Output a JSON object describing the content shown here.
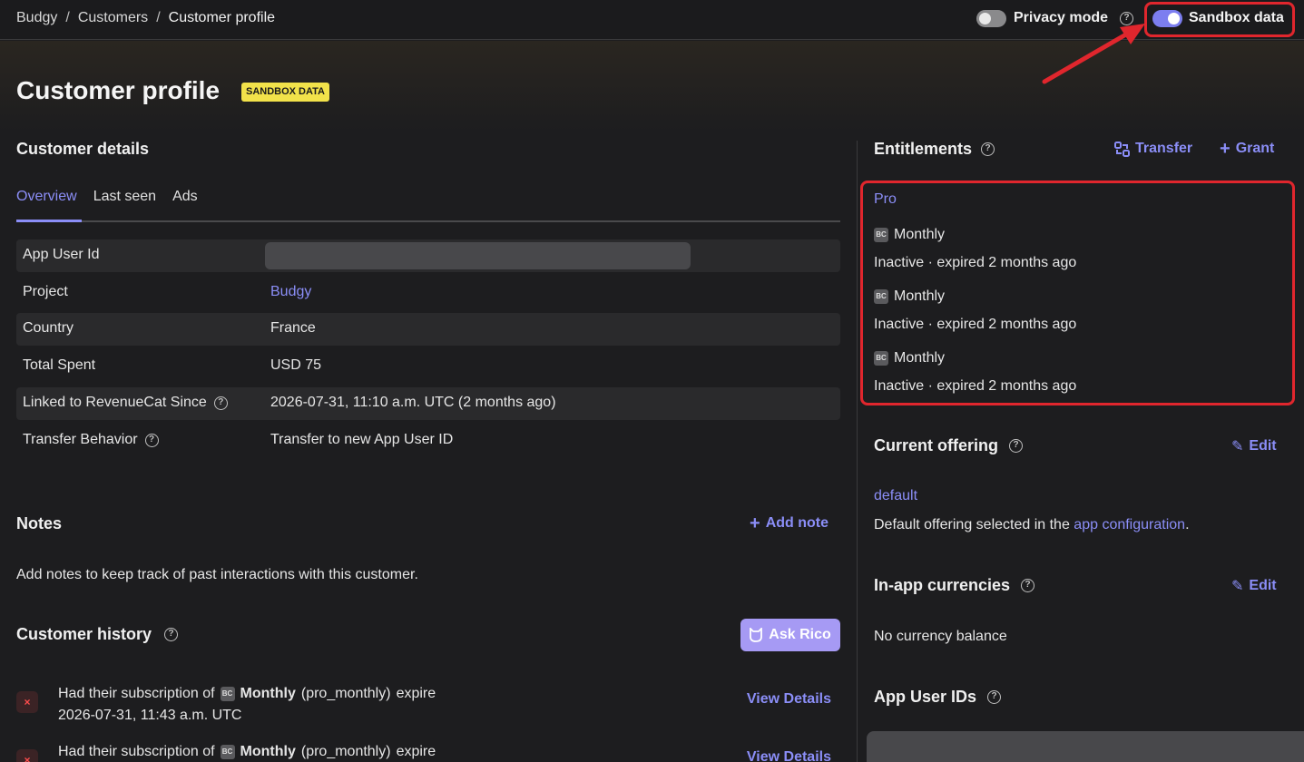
{
  "breadcrumb": {
    "items": [
      "Budgy",
      "Customers"
    ],
    "current": "Customer profile",
    "separator": "/"
  },
  "topbar": {
    "privacy_label": "Privacy mode",
    "privacy_on": false,
    "sandbox_label": "Sandbox data",
    "sandbox_on": true,
    "help_glyph": "?"
  },
  "page": {
    "title": "Customer profile",
    "badge": "SANDBOX DATA"
  },
  "customer_details": {
    "title": "Customer details",
    "tabs": [
      {
        "label": "Overview",
        "active": true
      },
      {
        "label": "Last seen",
        "active": false
      },
      {
        "label": "Ads",
        "active": false
      }
    ],
    "rows": [
      {
        "label": "App User Id",
        "value": "",
        "redacted": true
      },
      {
        "label": "Project",
        "value": "Budgy",
        "link": true
      },
      {
        "label": "Country",
        "value": "France"
      },
      {
        "label": "Total Spent",
        "value": "USD 75"
      },
      {
        "label": "Linked to RevenueCat Since",
        "value": "2026-07-31, 11:10 a.m. UTC (2 months ago)",
        "help": true
      },
      {
        "label": "Transfer Behavior",
        "value": "Transfer to new App User ID",
        "help": true
      }
    ]
  },
  "notes": {
    "title": "Notes",
    "add_label": "Add note",
    "empty_text": "Add notes to keep track of past interactions with this customer."
  },
  "history": {
    "title": "Customer history",
    "ask_label": "Ask Rico",
    "items": [
      {
        "prefix": "Had their subscription of",
        "product": "Monthly",
        "product_id": "(pro_monthly)",
        "verb": "expire",
        "time": "2026-07-31, 11:43 a.m. UTC",
        "action": "View Details"
      },
      {
        "prefix": "Had their subscription of",
        "product": "Monthly",
        "product_id": "(pro_monthly)",
        "verb": "expire",
        "time": "",
        "action": "View Details"
      }
    ]
  },
  "entitlements": {
    "title": "Entitlements",
    "transfer_label": "Transfer",
    "grant_label": "Grant",
    "name": "Pro",
    "items": [
      {
        "product": "Monthly",
        "status": "Inactive · expired 2 months ago"
      },
      {
        "product": "Monthly",
        "status": "Inactive · expired 2 months ago"
      },
      {
        "product": "Monthly",
        "status": "Inactive · expired 2 months ago"
      }
    ],
    "product_icon": "BC"
  },
  "current_offering": {
    "title": "Current offering",
    "edit_label": "Edit",
    "name": "default",
    "desc_prefix": "Default offering selected in the",
    "desc_link": "app configuration",
    "desc_suffix": "."
  },
  "currencies": {
    "title": "In-app currencies",
    "edit_label": "Edit",
    "empty_text": "No currency balance"
  },
  "app_user_ids": {
    "title": "App User IDs"
  },
  "colors": {
    "accent": "#8b8ef7",
    "annotation": "#e0262d",
    "badge": "#f2e24a",
    "error": "#ff4d4d"
  }
}
